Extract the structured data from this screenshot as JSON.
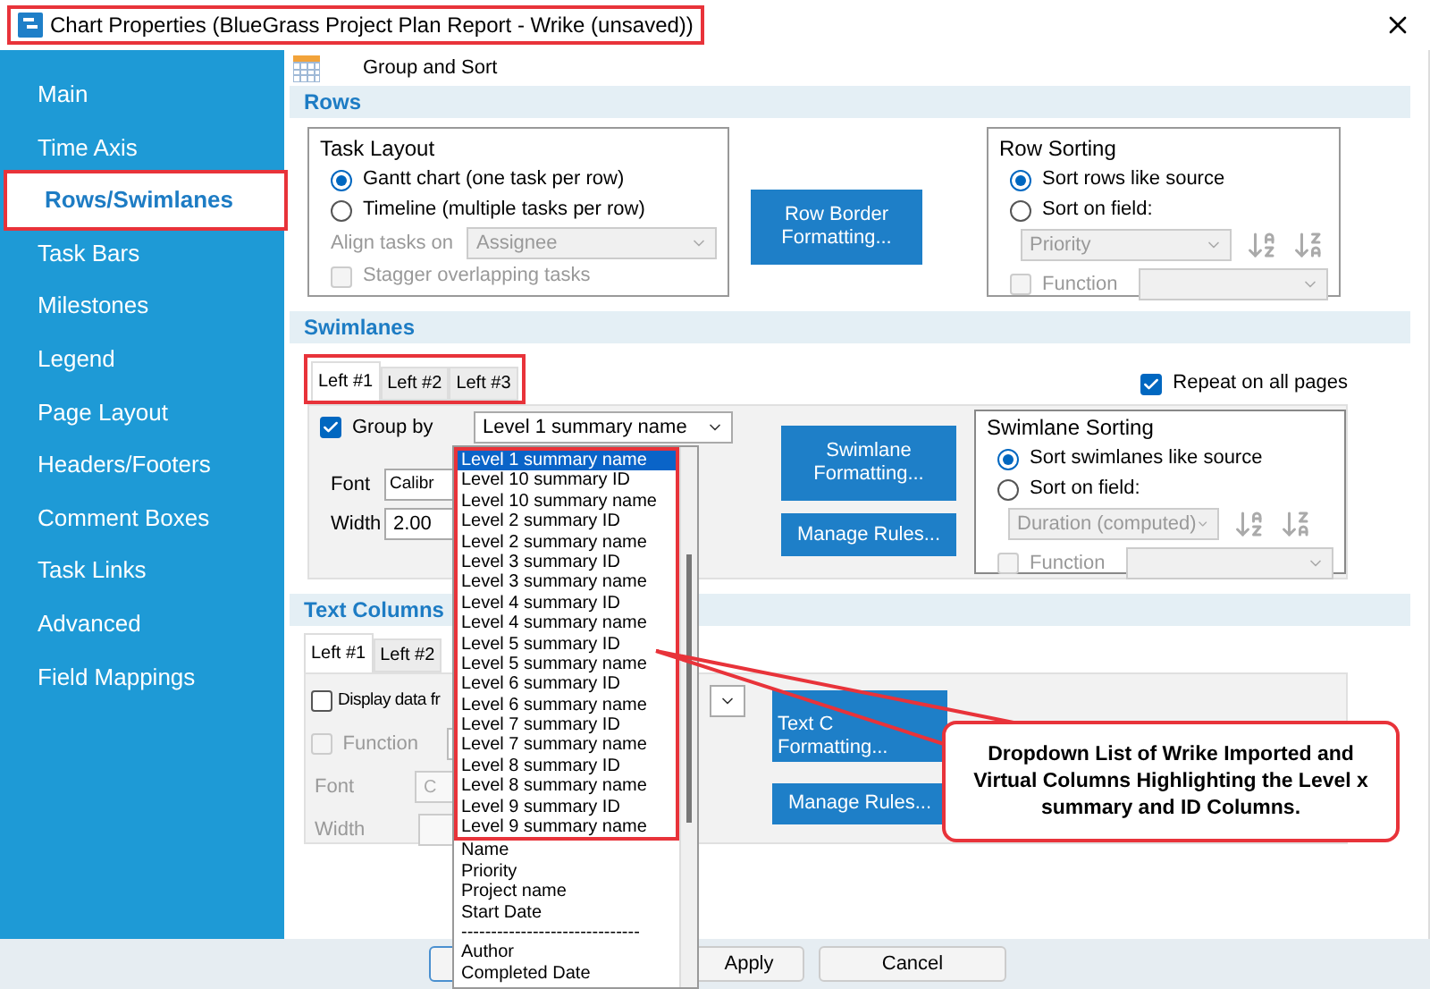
{
  "window": {
    "title": "Chart Properties (BlueGrass Project Plan Report - Wrike (unsaved))"
  },
  "sidebar": {
    "items": [
      {
        "label": "Main",
        "selected": false
      },
      {
        "label": "Time Axis",
        "selected": false
      },
      {
        "label": "Rows/Swimlanes",
        "selected": true
      },
      {
        "label": "Task Bars",
        "selected": false
      },
      {
        "label": "Milestones",
        "selected": false
      },
      {
        "label": "Legend",
        "selected": false
      },
      {
        "label": "Page Layout",
        "selected": false
      },
      {
        "label": "Headers/Footers",
        "selected": false
      },
      {
        "label": "Comment Boxes",
        "selected": false
      },
      {
        "label": "Task Links",
        "selected": false
      },
      {
        "label": "Advanced",
        "selected": false
      },
      {
        "label": "Field Mappings",
        "selected": false
      }
    ]
  },
  "header": {
    "title": "Group and Sort"
  },
  "rows": {
    "title": "Rows",
    "task_layout": {
      "title": "Task Layout",
      "options": [
        {
          "label": "Gantt chart (one task per row)",
          "selected": true
        },
        {
          "label": "Timeline (multiple tasks per row)",
          "selected": false
        }
      ],
      "align_label": "Align tasks on",
      "align_value": "Assignee",
      "align_disabled": true,
      "stagger": {
        "label": "Stagger overlapping tasks",
        "checked": false,
        "disabled": true
      }
    },
    "button": {
      "lines": [
        "Row Border",
        "Formatting..."
      ]
    },
    "row_sorting": {
      "title": "Row Sorting",
      "options": [
        {
          "label": "Sort rows like source",
          "selected": true
        },
        {
          "label": "Sort on field:",
          "selected": false
        }
      ],
      "field_value": "Priority",
      "function": {
        "label": "Function",
        "checked": false,
        "disabled": true
      }
    }
  },
  "swimlanes": {
    "title": "Swimlanes",
    "tabs": [
      {
        "label": "Left #1",
        "selected": true
      },
      {
        "label": "Left #2",
        "selected": false
      },
      {
        "label": "Left #3",
        "selected": false
      }
    ],
    "repeat": {
      "label": "Repeat on all pages",
      "checked": true
    },
    "group_by": {
      "label": "Group by",
      "checked": true,
      "value": "Level 1 summary name"
    },
    "font_label": "Font",
    "font_value": "Calibr",
    "width_label": "Width",
    "width_value": "2.00",
    "formatting_button": {
      "lines": [
        "Swimlane",
        "Formatting..."
      ]
    },
    "rules_button": "Manage Rules...",
    "sorting": {
      "title": "Swimlane Sorting",
      "options": [
        {
          "label": "Sort swimlanes like source",
          "selected": true
        },
        {
          "label": "Sort on field:",
          "selected": false
        }
      ],
      "field_value": "Duration (computed)",
      "function": {
        "label": "Function",
        "checked": false,
        "disabled": true
      }
    }
  },
  "text_columns": {
    "title": "Text Columns",
    "tabs": [
      {
        "label": "Left #1",
        "selected": true
      },
      {
        "label": "Left #2",
        "selected": false
      }
    ],
    "display": {
      "label": "Display data fr",
      "checked": false
    },
    "function": {
      "label": "Function",
      "checked": false,
      "disabled": true
    },
    "font_label": "Font",
    "font_value": "C",
    "width_label": "Width",
    "formatting_button": {
      "lines": [
        "Text C",
        "Formatting..."
      ]
    },
    "rules_button": "Manage Rules..."
  },
  "dropdown": {
    "highlighted_items": [
      {
        "label": "Level 1 summary name",
        "selected": true
      },
      {
        "label": "Level 10 summary ID",
        "selected": false
      },
      {
        "label": "Level 10 summary name",
        "selected": false
      },
      {
        "label": "Level 2 summary ID",
        "selected": false
      },
      {
        "label": "Level 2 summary name",
        "selected": false
      },
      {
        "label": "Level 3 summary ID",
        "selected": false
      },
      {
        "label": "Level 3 summary name",
        "selected": false
      },
      {
        "label": "Level 4 summary ID",
        "selected": false
      },
      {
        "label": "Level 4 summary name",
        "selected": false
      },
      {
        "label": "Level 5 summary ID",
        "selected": false
      },
      {
        "label": "Level 5 summary name",
        "selected": false
      },
      {
        "label": "Level 6 summary ID",
        "selected": false
      },
      {
        "label": "Level 6 summary name",
        "selected": false
      },
      {
        "label": "Level 7 summary ID",
        "selected": false
      },
      {
        "label": "Level 7 summary name",
        "selected": false
      },
      {
        "label": "Level 8 summary ID",
        "selected": false
      },
      {
        "label": "Level 8 summary name",
        "selected": false
      },
      {
        "label": "Level 9 summary ID",
        "selected": false
      },
      {
        "label": "Level 9 summary name",
        "selected": false
      }
    ],
    "other_items": [
      {
        "label": "Name",
        "selected": false
      },
      {
        "label": "Priority",
        "selected": false
      },
      {
        "label": "Project name",
        "selected": false
      },
      {
        "label": "Start Date",
        "selected": false
      },
      {
        "label": "------------------------------",
        "selected": false
      },
      {
        "label": "Author",
        "selected": false
      },
      {
        "label": "Completed Date",
        "selected": false
      }
    ]
  },
  "footer": {
    "buttons": [
      "Apply",
      "Cancel"
    ]
  },
  "callout": {
    "text": "Dropdown List of Wrike Imported and Virtual Columns Highlighting the Level x summary and ID Columns."
  }
}
